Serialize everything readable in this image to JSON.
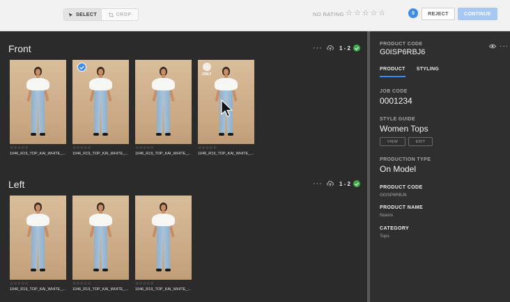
{
  "toolbar": {
    "select_label": "SELECT",
    "crop_label": "CROP",
    "rating_label": "NO RATING",
    "rating_stars": [
      "☆",
      "☆",
      "☆",
      "☆",
      "☆"
    ],
    "counter": "0",
    "reject_label": "REJECT",
    "continue_label": "CONTINUE"
  },
  "sections": [
    {
      "title": "Front",
      "range": "1 - 2",
      "thumbs": [
        {
          "stars": "☆☆☆☆☆",
          "name": "1046_R19_TOP_KAI_WHITE_..."
        },
        {
          "stars": "☆☆☆☆☆",
          "name": "1046_R19_TOP_KAI_WHITE_..."
        },
        {
          "stars": "☆☆☆☆☆",
          "name": "1046_R19_TOP_KAI_WHITE_..."
        },
        {
          "stars": "☆☆☆☆☆",
          "name": "1046_R19_TOP_KAI_WHITE_...",
          "tag": "ONLY"
        }
      ]
    },
    {
      "title": "Left",
      "range": "1 - 2",
      "thumbs": [
        {
          "stars": "☆☆☆☆☆",
          "name": "1046_R19_TOP_KAI_WHITE_..."
        },
        {
          "stars": "☆☆☆☆☆",
          "name": "1046_R19_TOP_KAI_WHITE_..."
        },
        {
          "stars": "☆☆☆☆☆",
          "name": "1046_R19_TOP_KAI_WHITE_..."
        }
      ]
    }
  ],
  "panel": {
    "product_code_label": "PRODUCT CODE",
    "product_code_value": "G0ISP6RBJ6",
    "tabs": [
      "PRODUCT",
      "STYLING"
    ],
    "job_code_label": "JOB CODE",
    "job_code_value": "0001234",
    "style_guide_label": "STYLE GUIDE",
    "style_guide_value": "Women Tops",
    "view_label": "VIEW",
    "edit_label": "EDIT",
    "production_type_label": "PRODUCTION TYPE",
    "production_type_value": "On Model",
    "product_code2_label": "PRODUCT CODE",
    "product_code2_value": "G0ISP6RBJ6",
    "product_name_label": "PRODUCT NAME",
    "product_name_value": "Noemi",
    "category_label": "CATEGORY",
    "category_value": "Tops"
  },
  "colors": {
    "accent": "#3d8bea",
    "success": "#3fae49"
  }
}
